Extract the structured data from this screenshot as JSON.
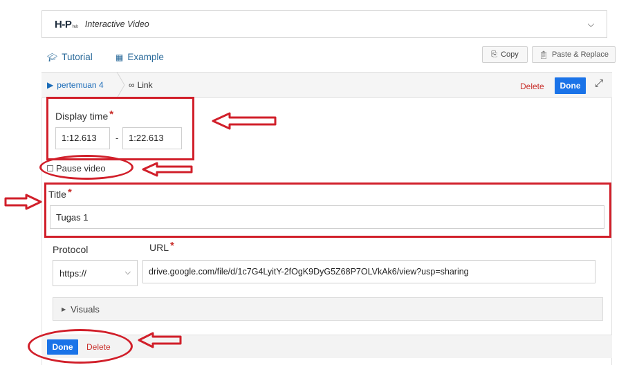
{
  "header": {
    "logo": "H-P",
    "logo_sub": "hub",
    "content_type": "Interactive Video",
    "chevron_icon": "chevron-down-icon"
  },
  "help_links": {
    "tutorial": "Tutorial",
    "example": "Example"
  },
  "clipboard": {
    "copy": "Copy",
    "paste_replace": "Paste & Replace"
  },
  "breadcrumb": {
    "parent": "pertemuan 4",
    "current": "Link",
    "delete": "Delete",
    "done": "Done"
  },
  "form": {
    "display_time_label": "Display time",
    "required_mark": "*",
    "start_time": "1:12.613",
    "separator": "-",
    "end_time": "1:22.613",
    "pause_label": "Pause video",
    "pause_checked": false,
    "title_label": "Title",
    "title_value": "Tugas 1",
    "protocol_label": "Protocol",
    "protocol_value": "https://",
    "url_label": "URL",
    "url_value": "drive.google.com/file/d/1c7G4LyitY-2fOgK9DyG5Z68P7OLVkAk6/view?usp=sharing",
    "visuals_label": "Visuals"
  },
  "footer": {
    "done": "Done",
    "delete": "Delete"
  },
  "colors": {
    "accent_blue": "#1a73e8",
    "link_blue": "#2a6a9a",
    "danger_red": "#c9302c",
    "annotation_red": "#d11f2a"
  }
}
